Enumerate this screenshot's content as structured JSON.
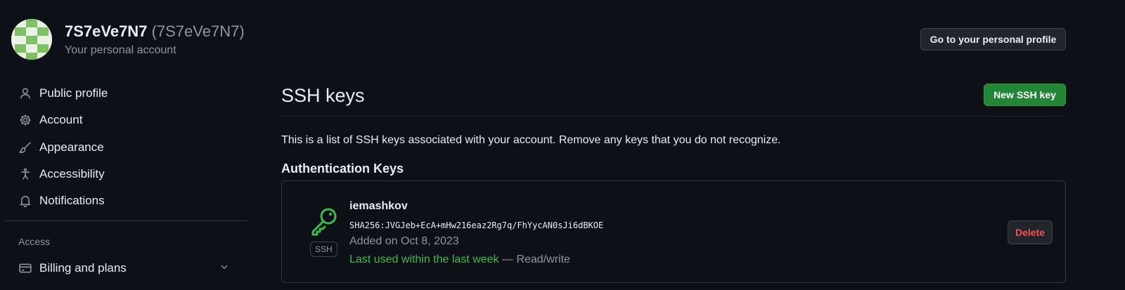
{
  "account": {
    "name": "7S7eVe7N7",
    "login": "(7S7eVe7N7)",
    "subtitle": "Your personal account",
    "profile_button": "Go to your personal profile"
  },
  "sidebar": {
    "items": [
      {
        "label": "Public profile",
        "icon": "person-icon"
      },
      {
        "label": "Account",
        "icon": "gear-icon"
      },
      {
        "label": "Appearance",
        "icon": "paintbrush-icon"
      },
      {
        "label": "Accessibility",
        "icon": "accessibility-icon"
      },
      {
        "label": "Notifications",
        "icon": "bell-icon"
      }
    ],
    "access_heading": "Access",
    "access_items": [
      {
        "label": "Billing and plans",
        "icon": "credit-card-icon"
      }
    ]
  },
  "main": {
    "title": "SSH keys",
    "new_button": "New SSH key",
    "description": "This is a list of SSH keys associated with your account. Remove any keys that you do not recognize.",
    "section_heading": "Authentication Keys",
    "keys": [
      {
        "title": "iemashkov",
        "fingerprint": "SHA256:JVGJeb+EcA+mHw216eaz2Rg7q/FhYycAN0sJi6dBKOE",
        "added": "Added on Oct 8, 2023",
        "last_used": "Last used within the last week",
        "access": " — Read/write",
        "type_label": "SSH",
        "delete_label": "Delete"
      }
    ]
  },
  "colors": {
    "background": "#0d1117",
    "accent_green": "#238636",
    "success_text": "#3fb950",
    "danger_text": "#f85149"
  }
}
